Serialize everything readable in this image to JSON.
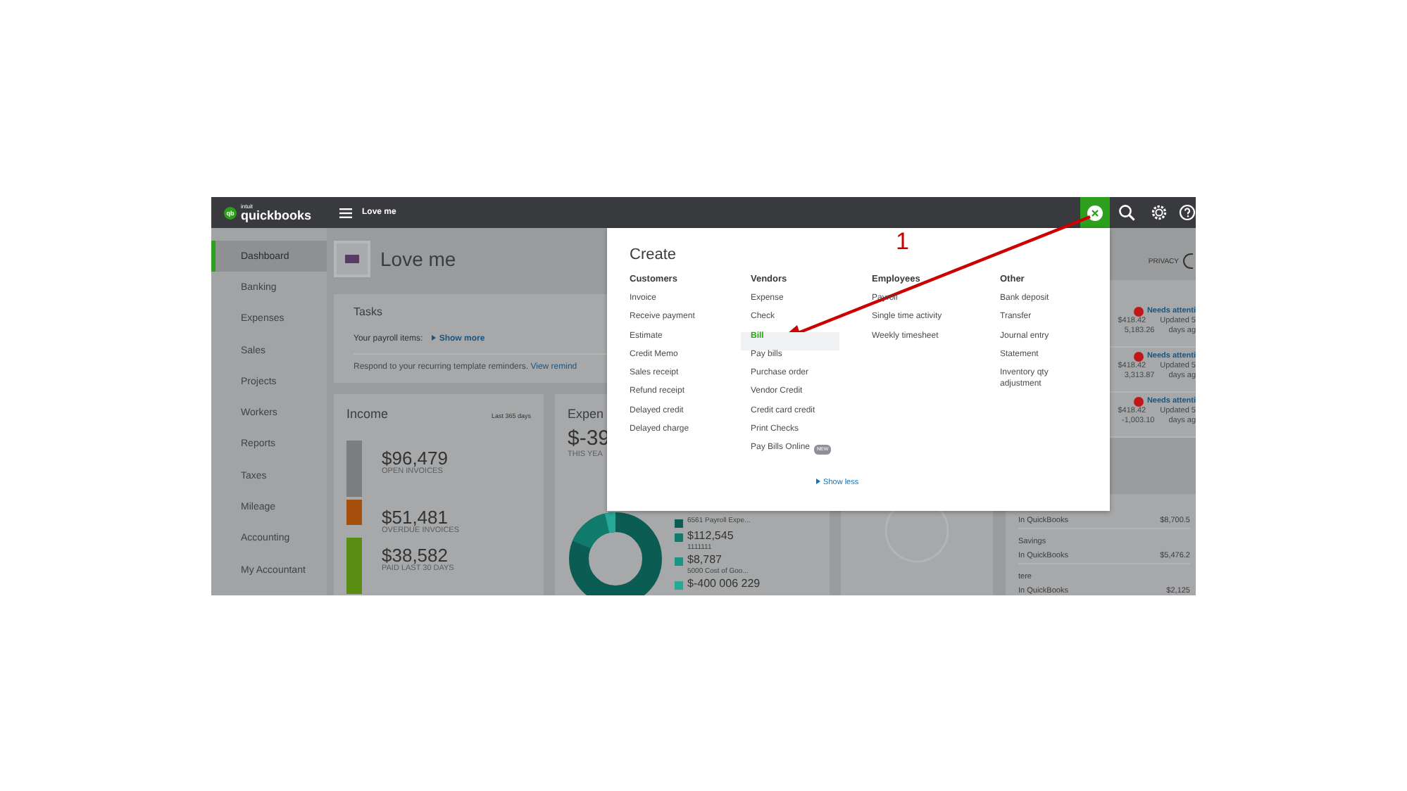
{
  "topbar": {
    "logo_mark": "qb",
    "brand_small": "intuit",
    "brand": "quickbooks",
    "company": "Love me"
  },
  "sidebar": {
    "items": [
      {
        "label": "Dashboard",
        "selected": true
      },
      {
        "label": "Banking",
        "selected": false
      },
      {
        "label": "Expenses",
        "selected": false
      },
      {
        "label": "Sales",
        "selected": false
      },
      {
        "label": "Projects",
        "selected": false
      },
      {
        "label": "Workers",
        "selected": false
      },
      {
        "label": "Reports",
        "selected": false
      },
      {
        "label": "Taxes",
        "selected": false
      },
      {
        "label": "Mileage",
        "selected": false
      },
      {
        "label": "Accounting",
        "selected": false
      },
      {
        "label": "My Accountant",
        "selected": false
      }
    ]
  },
  "company_header": {
    "name": "Love me"
  },
  "tasks": {
    "title": "Tasks",
    "payroll_label": "Your payroll items:",
    "show_more": "Show more",
    "reminder_text": "Respond to your recurring template reminders.",
    "reminder_link": "View remind"
  },
  "income": {
    "title": "Income",
    "period": "Last 365 days",
    "items": [
      {
        "amount": "$96,479",
        "label": "OPEN INVOICES",
        "color": "#7c7d80"
      },
      {
        "amount": "$51,481",
        "label": "OVERDUE INVOICES",
        "color": "#a64e0c"
      },
      {
        "amount": "$38,582",
        "label": "PAID LAST 30 DAYS",
        "color": "#5b8c12"
      }
    ]
  },
  "expenses": {
    "title": "Expen",
    "amount": "$-39",
    "period": "THIS YEA",
    "legend": [
      {
        "label": "6561 Payroll Expe...",
        "color": "#0b5c52"
      },
      {
        "amount": "$112,545",
        "label": "1111111",
        "color": "#107a6c"
      },
      {
        "amount": "$8,787",
        "label": "5000 Cost of Goo...",
        "color": "#1a9484"
      },
      {
        "amount": "$-400 006 229",
        "color": "#27a898"
      }
    ]
  },
  "privacy": {
    "label": "PRIVACY"
  },
  "bank_alerts": [
    {
      "status": "Needs attenti",
      "amount": "$418.42",
      "balance": "5,183.26",
      "updated": "Updated 5",
      "ago": "days ag"
    },
    {
      "status": "Needs attenti",
      "amount": "$418.42",
      "balance": "3,313.87",
      "updated": "Updated 5",
      "ago": "days ag"
    },
    {
      "status": "Needs attenti",
      "amount": "$418.42",
      "balance": "-1,003.10",
      "updated": "Updated 5",
      "ago": "days ag"
    }
  ],
  "accounts": [
    {
      "source": "In QuickBooks",
      "amount": "$8,700.5"
    },
    {
      "name": "Savings",
      "source": "In QuickBooks",
      "amount": "$5,476.2"
    },
    {
      "name": "tere",
      "source": "In QuickBooks",
      "amount": "$2,125"
    }
  ],
  "create_menu": {
    "title": "Create",
    "show_less": "Show less",
    "columns": [
      {
        "heading": "Customers",
        "items": [
          {
            "label": "Invoice",
            "selected": false
          },
          {
            "label": "Receive payment",
            "selected": false
          },
          {
            "label": "Estimate",
            "selected": false
          },
          {
            "label": "Credit Memo",
            "selected": false
          },
          {
            "label": "Sales receipt",
            "selected": false
          },
          {
            "label": "Refund receipt",
            "selected": false
          },
          {
            "label": "Delayed credit",
            "selected": false
          },
          {
            "label": "Delayed charge",
            "selected": false
          }
        ]
      },
      {
        "heading": "Vendors",
        "items": [
          {
            "label": "Expense",
            "selected": false
          },
          {
            "label": "Check",
            "selected": false
          },
          {
            "label": "Bill",
            "selected": true
          },
          {
            "label": "Pay bills",
            "selected": false
          },
          {
            "label": "Purchase order",
            "selected": false
          },
          {
            "label": "Vendor Credit",
            "selected": false
          },
          {
            "label": "Credit card credit",
            "selected": false
          },
          {
            "label": "Print Checks",
            "selected": false
          },
          {
            "label": "Pay Bills Online",
            "badge": "NEW",
            "selected": false
          }
        ]
      },
      {
        "heading": "Employees",
        "items": [
          {
            "label": "Payroll",
            "selected": false
          },
          {
            "label": "Single time activity",
            "selected": false
          },
          {
            "label": "Weekly timesheet",
            "selected": false
          }
        ]
      },
      {
        "heading": "Other",
        "items": [
          {
            "label": "Bank deposit",
            "selected": false
          },
          {
            "label": "Transfer",
            "selected": false
          },
          {
            "label": "Journal entry",
            "selected": false
          },
          {
            "label": "Statement",
            "selected": false
          },
          {
            "label": "Inventory qty adjustment",
            "selected": false
          }
        ]
      }
    ]
  },
  "annotation": {
    "label": "1"
  }
}
